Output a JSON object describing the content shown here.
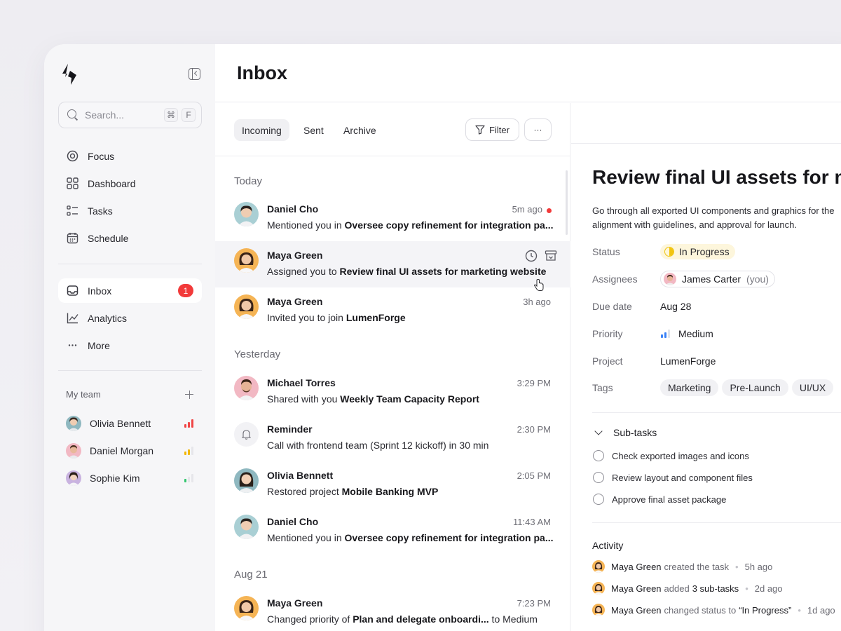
{
  "sidebar": {
    "search_placeholder": "Search...",
    "search_shortcut_1": "⌘",
    "search_shortcut_2": "F",
    "nav_primary": [
      {
        "label": "Focus",
        "icon": "target-icon"
      },
      {
        "label": "Dashboard",
        "icon": "grid-icon"
      },
      {
        "label": "Tasks",
        "icon": "checklist-icon"
      },
      {
        "label": "Schedule",
        "icon": "calendar-icon"
      }
    ],
    "nav_secondary": [
      {
        "label": "Inbox",
        "icon": "inbox-icon",
        "badge": "1",
        "active": true
      },
      {
        "label": "Analytics",
        "icon": "chart-line-icon"
      },
      {
        "label": "More",
        "icon": "ellipsis-icon"
      }
    ],
    "team_heading": "My team",
    "team": [
      {
        "name": "Olivia Bennett",
        "load": "high",
        "bar_colors": [
          "#f04646",
          "#f04646",
          "#f04646"
        ]
      },
      {
        "name": "Daniel Morgan",
        "load": "medium",
        "bar_colors": [
          "#f2b705",
          "#f2b705",
          "#e6e6ea"
        ]
      },
      {
        "name": "Sophie Kim",
        "load": "low",
        "bar_colors": [
          "#34c76f",
          "#e6e6ea",
          "#e6e6ea"
        ]
      }
    ]
  },
  "main": {
    "title": "Inbox",
    "tabs": [
      "Incoming",
      "Sent",
      "Archive"
    ],
    "filter_label": "Filter",
    "more_label": "···"
  },
  "sections": [
    "Today",
    "Yesterday",
    "Aug 21"
  ],
  "messages": [
    {
      "sender": "Daniel Cho",
      "prefix": "Mentioned you in ",
      "subject": "Oversee copy refinement for integration pa...",
      "time": "5m ago",
      "unread": true
    },
    {
      "sender": "Maya Green",
      "prefix": "Assigned you to ",
      "subject": "Review final UI assets for marketing website",
      "time": "",
      "hovered": true
    },
    {
      "sender": "Maya Green",
      "prefix": "Invited you to join ",
      "subject": "LumenForge",
      "time": "3h ago"
    },
    {
      "sender": "Michael Torres",
      "prefix": "Shared with you ",
      "subject": "Weekly Team Capacity Report",
      "time": "3:29 PM"
    },
    {
      "sender": "Reminder",
      "prefix": "Call with frontend team (Sprint 12 kickoff) in 30 min",
      "subject": "",
      "time": "2:30 PM"
    },
    {
      "sender": "Olivia Bennett",
      "prefix": "Restored project ",
      "subject": "Mobile Banking MVP",
      "time": "2:05 PM"
    },
    {
      "sender": "Daniel Cho",
      "prefix": "Mentioned you in ",
      "subject": "Oversee copy refinement for integration pa...",
      "time": "11:43 AM"
    },
    {
      "sender": "Maya Green",
      "prefix": "Changed priority of ",
      "subject": "Plan and delegate onboardi...",
      "suffix": " to Medium",
      "time": "7:23 PM"
    }
  ],
  "detail": {
    "title": "Review final UI assets for m",
    "description": "Go through all exported UI components and graphics for the alignment with guidelines, and approval for launch.",
    "props": {
      "status_label": "Status",
      "status_value": "In Progress",
      "assignees_label": "Assignees",
      "assignee_name": "James Carter",
      "assignee_you": "(you)",
      "due_label": "Due date",
      "due_value": "Aug 28",
      "priority_label": "Priority",
      "priority_value": "Medium",
      "project_label": "Project",
      "project_value": "LumenForge",
      "tags_label": "Tags",
      "tags": [
        "Marketing",
        "Pre-Launch",
        "UI/UX"
      ]
    },
    "subtasks_heading": "Sub-tasks",
    "subtasks": [
      "Check exported images and icons",
      "Review layout and component files",
      "Approve final asset package"
    ],
    "activity_heading": "Activity",
    "activity": [
      {
        "name": "Maya Green",
        "action": "created the task",
        "detail": "",
        "time": "5h ago"
      },
      {
        "name": "Maya Green",
        "action": "added",
        "detail": "3 sub-tasks",
        "time": "2d ago"
      },
      {
        "name": "Maya Green",
        "action": "changed status to",
        "detail": "“In Progress”",
        "time": "1d ago"
      }
    ]
  },
  "colors": {
    "accent_red": "#f23a3a",
    "status_yellow": "#f1c40f",
    "priority_blue": "#3b82f6"
  }
}
